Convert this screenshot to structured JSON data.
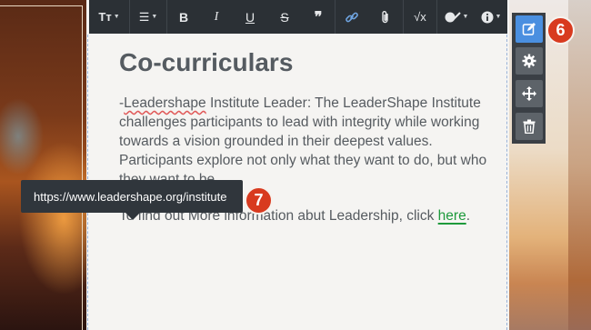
{
  "toolbar": {
    "buttons": [
      {
        "name": "text-size",
        "label": "Tт"
      },
      {
        "name": "list",
        "label": "☰"
      },
      {
        "name": "bold",
        "label": "B"
      },
      {
        "name": "italic",
        "label": "I"
      },
      {
        "name": "underline",
        "label": "U"
      },
      {
        "name": "strikethrough",
        "label": "S"
      },
      {
        "name": "quote",
        "label": "❞"
      },
      {
        "name": "link",
        "label": "🔗"
      },
      {
        "name": "attach",
        "label": "📎"
      },
      {
        "name": "formula",
        "label": "√x"
      },
      {
        "name": "style",
        "label": "🖌"
      },
      {
        "name": "info",
        "label": "ℹ"
      }
    ]
  },
  "content": {
    "title": "Co-curriculars",
    "para1_lead": "-",
    "para1_spell": "Leadershape",
    "para1_rest": " Institute Leader: The LeaderShape Institute challenges participants to lead with integrity while working towards a vision grounded in their deepest values.  Participants explore not only what they want to do, but who they want to be.",
    "para2_text": "To find out More information abut Leadership, click ",
    "para2_link": "here",
    "para2_end": "."
  },
  "tooltip": {
    "url": "https://www.leadershape.org/institute"
  },
  "badges": {
    "six": "6",
    "seven": "7"
  },
  "side_tools": {
    "icons": [
      "edit-icon",
      "settings-icon",
      "move-icon",
      "trash-icon"
    ]
  },
  "colors": {
    "toolbar_bg": "#2b3035",
    "link_green": "#1e9a3c",
    "badge_red": "#d83a1f",
    "active_blue": "#4a8fe0"
  }
}
